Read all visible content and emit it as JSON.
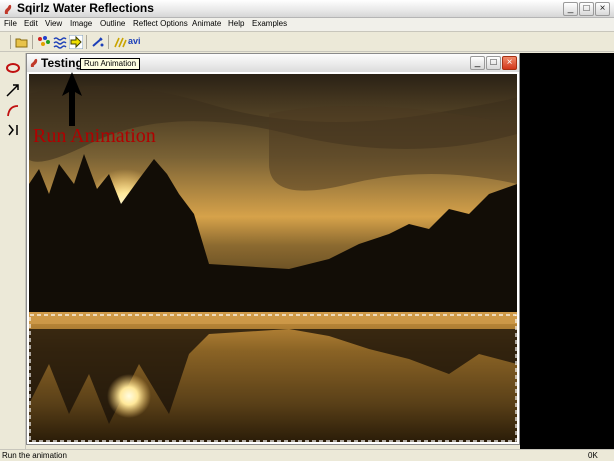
{
  "app": {
    "title": "Sqirlz Water Reflections"
  },
  "window_buttons": {
    "minimize": "_",
    "maximize": "□",
    "close": "×"
  },
  "menu": [
    "File",
    "Edit",
    "View",
    "Image",
    "Outline",
    "Reflect Options",
    "Animate",
    "Help",
    "Examples"
  ],
  "toolbar": {
    "icons": [
      "open-folder-icon",
      "palette-icon",
      "waves-icon",
      "run-animation-icon",
      "sparkle-icon",
      "avi-export-icon"
    ],
    "avi_label": "avi",
    "tooltip": "Run Animation"
  },
  "sidebar_tools": [
    "ellipse-tool-icon",
    "arrow-tool-icon",
    "curve-tool-icon",
    "step-tool-icon"
  ],
  "child_window": {
    "title": "Testing"
  },
  "annotation": {
    "text": "Run Animation"
  },
  "status": {
    "text": "Run the animation",
    "right": "0K"
  },
  "colors": {
    "annotation": "#b00000",
    "close_button": "#d2361a",
    "workspace": "#000000"
  }
}
